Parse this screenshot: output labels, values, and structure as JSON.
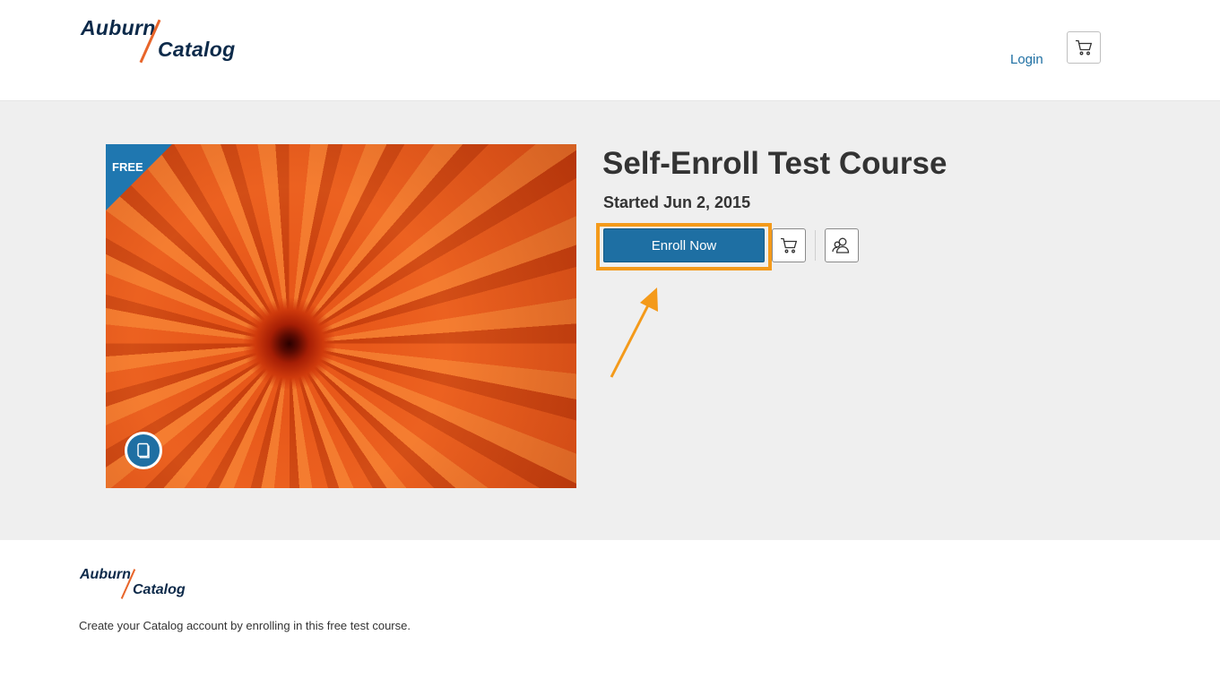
{
  "brand": {
    "logo_word1": "Auburn",
    "logo_word2": "Catalog",
    "accent": "#e8652a",
    "navy": "#0d2a4a"
  },
  "header": {
    "login_label": "Login",
    "cart_icon": "cart-icon"
  },
  "course": {
    "ribbon_label": "FREE",
    "title": "Self-Enroll Test Course",
    "start_text": "Started Jun 2, 2015",
    "enroll_label": "Enroll Now",
    "add_to_cart_icon": "cart-icon",
    "share_icon": "users-icon",
    "type_icon": "book-icon",
    "primary_color": "#1e6fa3",
    "highlight_color": "#f49a1a"
  },
  "footer": {
    "logo_word1": "Auburn",
    "logo_word2": "Catalog",
    "description": "Create your Catalog account by enrolling in this free test course."
  }
}
